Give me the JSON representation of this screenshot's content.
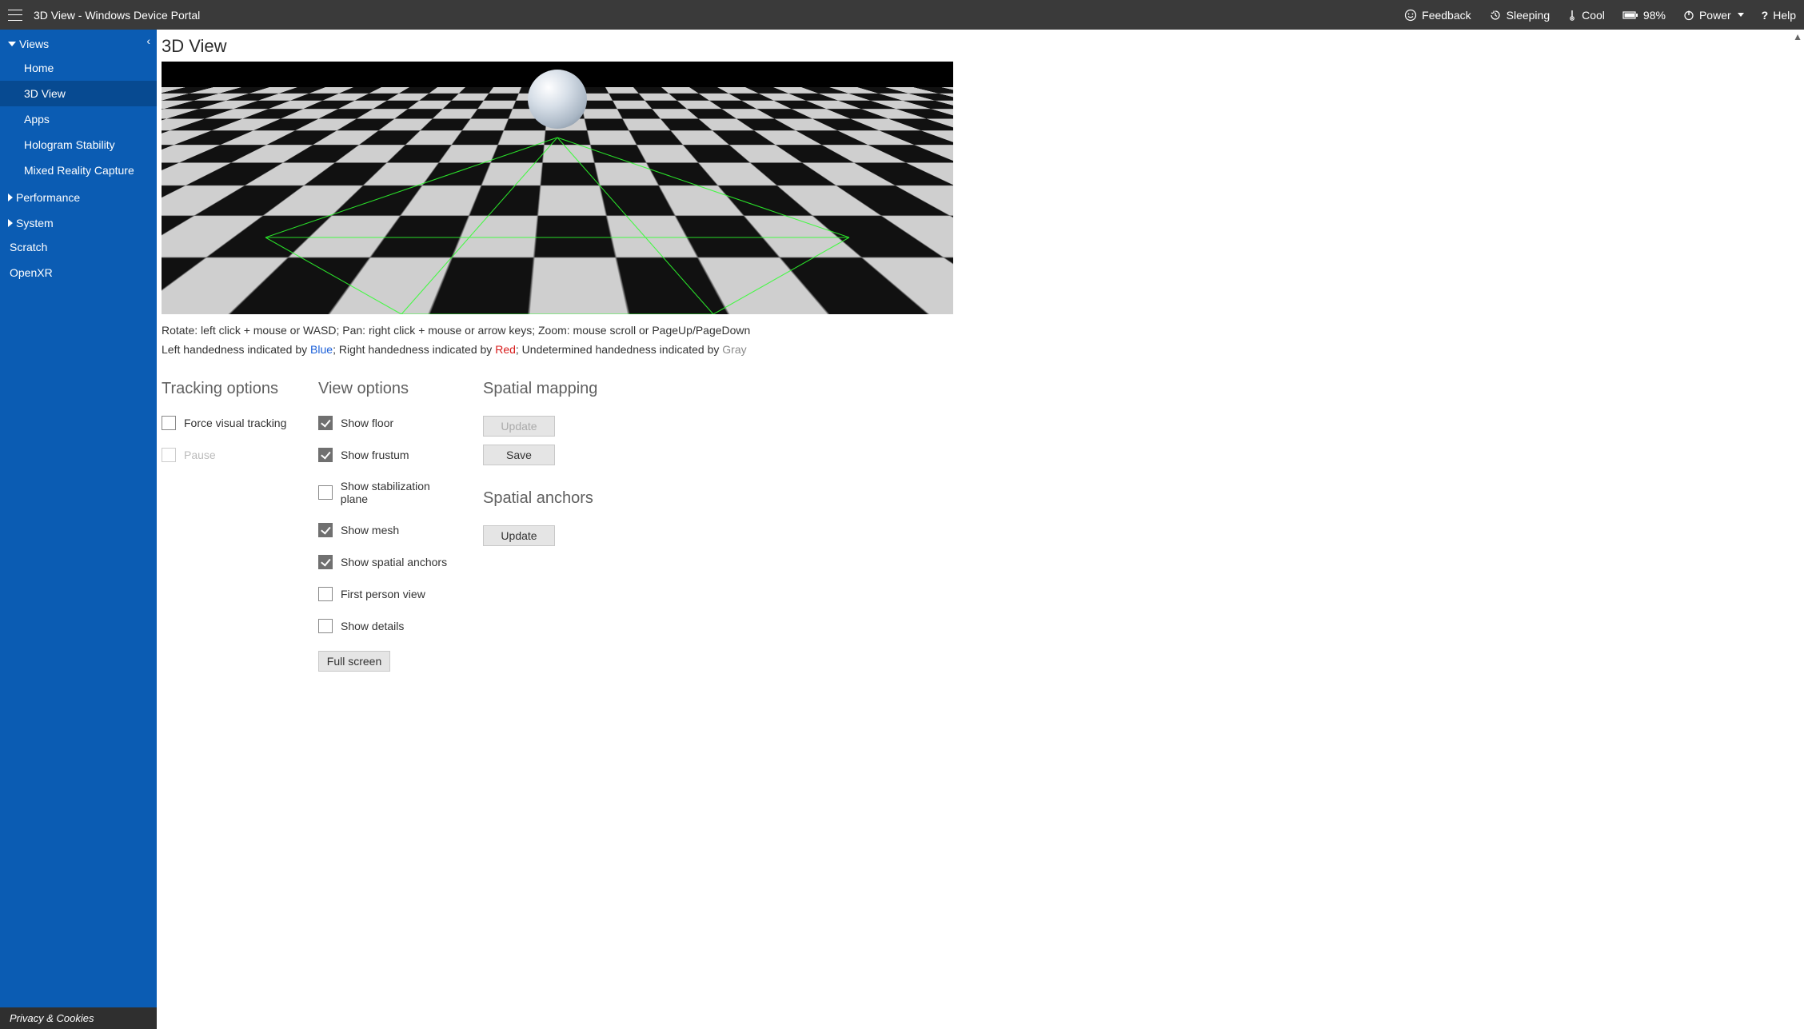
{
  "topbar": {
    "title": "3D View - Windows Device Portal",
    "feedback": "Feedback",
    "sleeping": "Sleeping",
    "cool": "Cool",
    "battery": "98%",
    "power": "Power",
    "help": "Help"
  },
  "sidebar": {
    "views_label": "Views",
    "items": {
      "home": "Home",
      "threeD": "3D View",
      "apps": "Apps",
      "hologram": "Hologram Stability",
      "mrc": "Mixed Reality Capture"
    },
    "performance": "Performance",
    "system": "System",
    "scratch": "Scratch",
    "openxr": "OpenXR",
    "footer": "Privacy & Cookies"
  },
  "page": {
    "title": "3D View",
    "controls_help": "Rotate: left click + mouse or WASD; Pan: right click + mouse or arrow keys; Zoom: mouse scroll or PageUp/PageDown",
    "hand_left_pre": "Left handedness indicated by ",
    "hand_left_color": "Blue",
    "hand_sep1": "; Right handedness indicated by ",
    "hand_right_color": "Red",
    "hand_sep2": "; Undetermined handedness indicated by ",
    "hand_undet_color": "Gray"
  },
  "tracking": {
    "title": "Tracking options",
    "force": "Force visual tracking",
    "pause": "Pause"
  },
  "view": {
    "title": "View options",
    "floor": "Show floor",
    "frustum": "Show frustum",
    "stab": "Show stabilization plane",
    "mesh": "Show mesh",
    "anchors": "Show spatial anchors",
    "fpv": "First person view",
    "details": "Show details",
    "fullscreen": "Full screen"
  },
  "spatial": {
    "mapping_title": "Spatial mapping",
    "update": "Update",
    "save": "Save",
    "anchors_title": "Spatial anchors",
    "anchors_update": "Update"
  }
}
